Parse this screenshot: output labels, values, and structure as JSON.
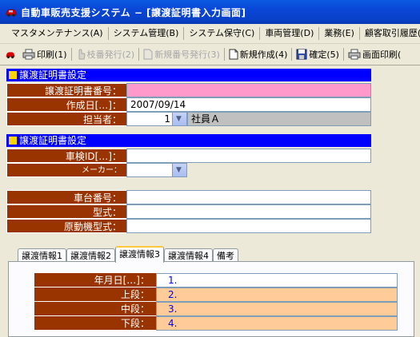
{
  "window": {
    "title": "自動車販売支援システム − [譲渡証明書入力画面]"
  },
  "menu": [
    "マスタメンテナンス(A)",
    "システム管理(B)",
    "システム保守(C)",
    "車両管理(D)",
    "業務(E)",
    "顧客取引履歴(F"
  ],
  "toolbar": {
    "print": "印刷(1)",
    "branch_issue": "枝番発行(2)",
    "new_number_issue": "新規番号発行(3)",
    "new_create": "新規作成(4)",
    "confirm": "確定(5)",
    "screen_print": "画面印刷("
  },
  "section1": {
    "header": "譲渡証明書設定",
    "fields": {
      "cert_number_label": "譲渡証明書番号：",
      "cert_number_value": "",
      "created_date_label": "作成日[…]：",
      "created_date_value": "2007/09/14",
      "staff_label": "担当者：",
      "staff_code": "1",
      "staff_name": "社員Ａ"
    }
  },
  "section2": {
    "header": "譲渡証明書設定",
    "fields": {
      "inspection_id_label": "車検ID[…]：",
      "inspection_id_value": "",
      "maker_label": "メーカー：",
      "maker_value": "",
      "chassis_label": "車台番号：",
      "chassis_value": "",
      "model_label": "型式：",
      "model_value": "",
      "engine_model_label": "原動機型式：",
      "engine_model_value": ""
    }
  },
  "tabs": [
    "譲渡情報1",
    "譲渡情報2",
    "譲渡情報3",
    "譲渡情報4",
    "備考"
  ],
  "active_tab": "譲渡情報3",
  "tab3": {
    "date_label": "年月日[…]：",
    "date_value": "1.",
    "upper_label": "上段：",
    "upper_value": "2.",
    "middle_label": "中段：",
    "middle_value": "3.",
    "lower_label": "下段：",
    "lower_value": "4."
  },
  "colors": {
    "section_header": "#0000ff",
    "label_bg": "#993300",
    "pink_field": "#ff99cc",
    "peach_field": "#ffcc99",
    "blue_text": "#0000ff"
  }
}
